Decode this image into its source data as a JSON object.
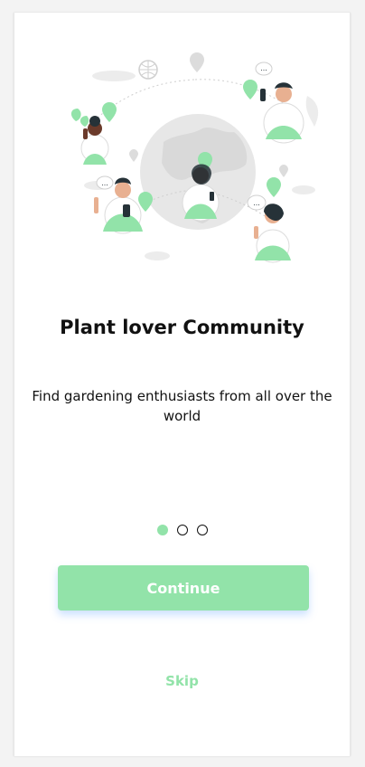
{
  "onboarding": {
    "title": "Plant lover Community",
    "subtitle": "Find gardening enthusiasts from all over the world",
    "pagination_total": 3,
    "pagination_active_index": 1,
    "continue_label": "Continue",
    "skip_label": "Skip",
    "illustration": "globe-community-illustration",
    "chat_bubble_text": "..."
  },
  "colors": {
    "accent": "#92e3a9",
    "text": "#111111",
    "illustration_gray": "#e7e7e7",
    "skin_dark": "#6b3a2a",
    "skin_tan": "#e8b091",
    "hair": "#263238"
  }
}
